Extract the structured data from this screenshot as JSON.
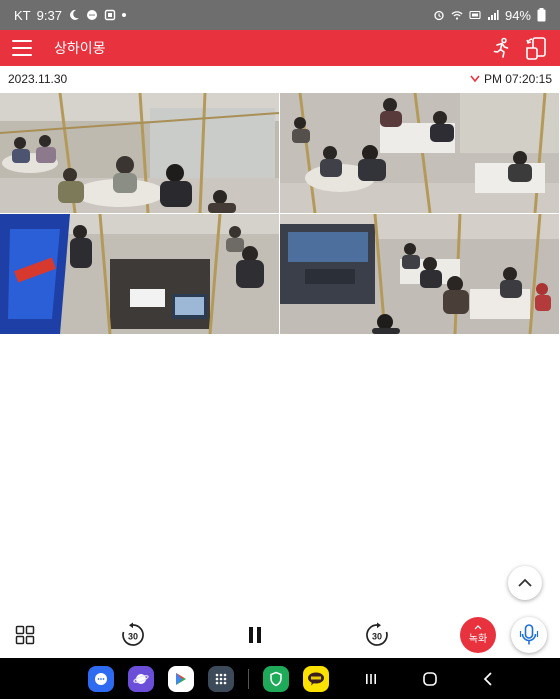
{
  "status_bar": {
    "carrier": "KT",
    "time": "9:37",
    "battery": "94%"
  },
  "app_bar": {
    "title": "상하이몽"
  },
  "playback": {
    "date": "2023.11.30",
    "time": "PM 07:20:15"
  },
  "cameras": [
    {
      "id": "cam-1"
    },
    {
      "id": "cam-2"
    },
    {
      "id": "cam-3"
    },
    {
      "id": "cam-4"
    }
  ],
  "controls": {
    "rewind_label": "30",
    "forward_label": "30",
    "record_label": "녹화"
  },
  "colors": {
    "accent": "#e8333f",
    "status_bar": "#6e6e6e",
    "nav_bar": "#000000",
    "mic_blue": "#1e6fd9"
  }
}
